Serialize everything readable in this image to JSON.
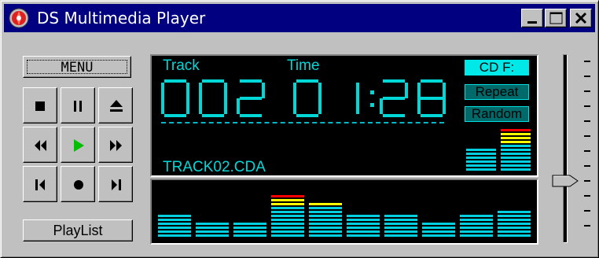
{
  "window": {
    "title": "DS Multimedia Player",
    "icon": "cd-disc-icon"
  },
  "titlebar_buttons": [
    "minimize-icon",
    "maximize-icon",
    "close-icon"
  ],
  "controls": {
    "menu_label": "MENU",
    "playlist_label": "PlayList",
    "buttons": [
      "stop",
      "pause",
      "eject",
      "rewind",
      "play",
      "fast-forward",
      "previous-track",
      "record",
      "next-track"
    ]
  },
  "display": {
    "track_label": "Track",
    "time_label": "Time",
    "track_number": "002",
    "time_value": "01:28",
    "file_name": "TRACK02.CDA",
    "modes": {
      "cd": "CD F:",
      "repeat": "Repeat",
      "random": "Random"
    },
    "vu_levels": [
      0.55,
      0.95
    ]
  },
  "spectrum": {
    "levels": [
      0.5,
      0.35,
      0.28,
      0.85,
      0.72,
      0.45,
      0.45,
      0.35,
      0.45,
      0.55
    ]
  },
  "volume": {
    "level": 0.3
  },
  "colors": {
    "accent": "#00d8d8",
    "title_bar": "#000080",
    "bar_cyan": "#00d0e0",
    "bar_yellow": "#ffff00",
    "bar_red": "#ff0000"
  }
}
